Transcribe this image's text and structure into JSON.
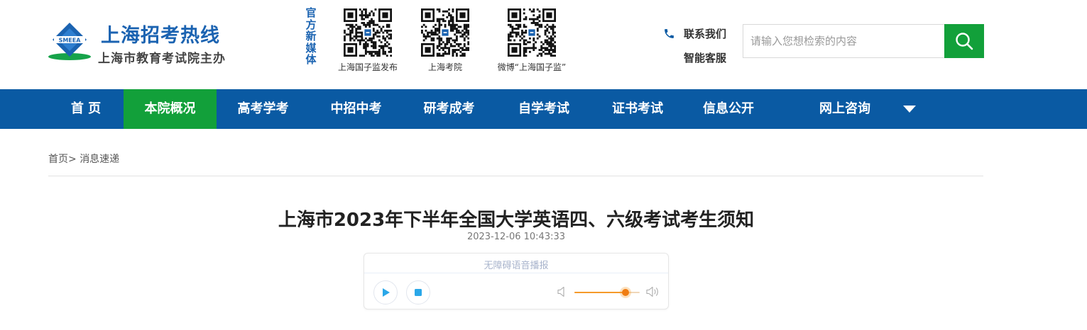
{
  "header": {
    "logo_title": "上海招考热线",
    "logo_subtitle": "上海市教育考试院主办",
    "logo_badge": "SMEEA",
    "media_label": "官方新媒体",
    "qr_codes": [
      {
        "caption": "上海国子监发布"
      },
      {
        "caption": "上海考院"
      },
      {
        "caption": "微博“上海国子监”"
      }
    ],
    "contact_label": "联系我们",
    "service_label": "智能客服",
    "search_placeholder": "请输入您想检索的内容"
  },
  "nav": {
    "items": [
      {
        "label": "首 页"
      },
      {
        "label": "本院概况"
      },
      {
        "label": "高考学考"
      },
      {
        "label": "中招中考"
      },
      {
        "label": "研考成考"
      },
      {
        "label": "自学考试"
      },
      {
        "label": "证书考试"
      },
      {
        "label": "信息公开"
      },
      {
        "label": "网上咨询"
      }
    ],
    "active_index": 1
  },
  "breadcrumb": {
    "home": "首页>",
    "current": "消息速递"
  },
  "article": {
    "title": "上海市2023年下半年全国大学英语四、六级考试考生须知",
    "date": "2023-12-06 10:43:33"
  },
  "player": {
    "label": "无障碍语音播报",
    "volume": 0.78
  },
  "colors": {
    "brand_blue": "#0a5aa3",
    "accent_green": "#12a03a",
    "volume_orange": "#f07d12"
  }
}
